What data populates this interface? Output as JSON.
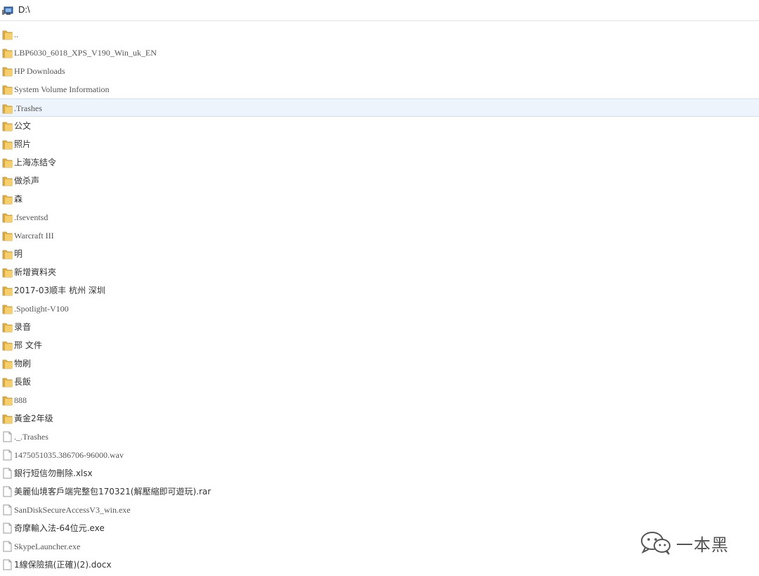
{
  "address": {
    "path": "D:\\"
  },
  "rows": [
    {
      "name": "..",
      "type": "folder"
    },
    {
      "name": "LBP6030_6018_XPS_V190_Win_uk_EN",
      "type": "folder"
    },
    {
      "name": "HP Downloads",
      "type": "folder"
    },
    {
      "name": "System Volume Information",
      "type": "folder"
    },
    {
      "name": ".Trashes",
      "type": "folder",
      "selected": true
    },
    {
      "name": "公文",
      "type": "folder"
    },
    {
      "name": "照片",
      "type": "folder"
    },
    {
      "name": "上海冻结令",
      "type": "folder"
    },
    {
      "name": "做杀声",
      "type": "folder"
    },
    {
      "name": "森",
      "type": "folder"
    },
    {
      "name": ".fseventsd",
      "type": "folder"
    },
    {
      "name": "Warcraft III",
      "type": "folder"
    },
    {
      "name": "明",
      "type": "folder"
    },
    {
      "name": "新增資料夾",
      "type": "folder"
    },
    {
      "name": "2017-03顺丰 杭州 深圳",
      "type": "folder"
    },
    {
      "name": ".Spotlight-V100",
      "type": "folder"
    },
    {
      "name": "录音",
      "type": "folder"
    },
    {
      "name": "邢 文件",
      "type": "folder"
    },
    {
      "name": "物刷",
      "type": "folder"
    },
    {
      "name": "長飯",
      "type": "folder"
    },
    {
      "name": "888",
      "type": "folder"
    },
    {
      "name": "黃金2年级",
      "type": "folder"
    },
    {
      "name": "._.Trashes",
      "type": "file"
    },
    {
      "name": "1475051035.386706-96000.wav",
      "type": "file"
    },
    {
      "name": "銀行短信勿刪除.xlsx",
      "type": "file"
    },
    {
      "name": "美麗仙境客戶端完整包170321(解壓縮即可遊玩).rar",
      "type": "file"
    },
    {
      "name": "SanDiskSecureAccessV3_win.exe",
      "type": "file"
    },
    {
      "name": "奇摩輸入法-64位元.exe",
      "type": "file"
    },
    {
      "name": "SkypeLauncher.exe",
      "type": "file"
    },
    {
      "name": "1線保險搞(正確)(2).docx",
      "type": "file"
    }
  ],
  "watermark": {
    "text": "一本黑",
    "icon": "wechat-icon"
  },
  "colors": {
    "folder": "#e8b84a",
    "selected_bg": "#eef4fc",
    "selected_border": "#cfe0f5"
  }
}
